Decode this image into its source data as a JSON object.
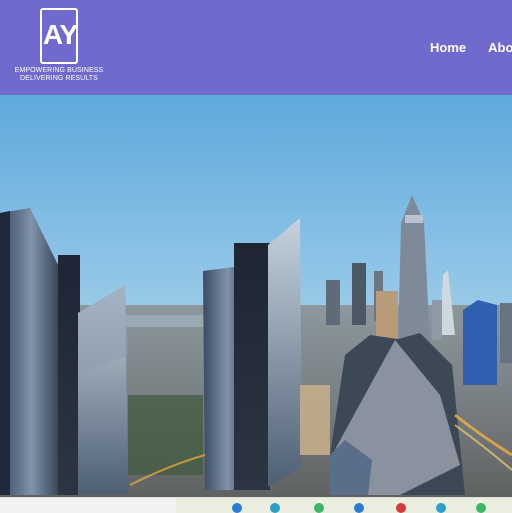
{
  "logo": {
    "mark": "AY",
    "tagline_line1": "EMPOWERING BUSINESS",
    "tagline_line2": "DELIVERING RESULTS"
  },
  "nav": {
    "items": [
      {
        "label": "Home"
      },
      {
        "label": "Abo"
      }
    ]
  },
  "colors": {
    "header_bg": "#6f6acd",
    "nav_text": "#ffffff"
  }
}
